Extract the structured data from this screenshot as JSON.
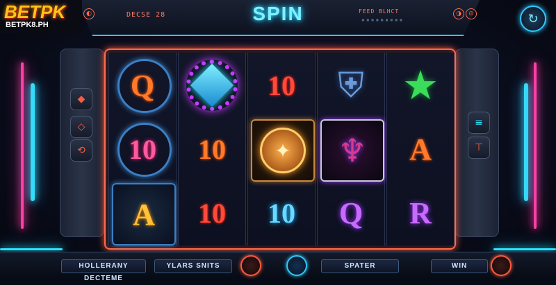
{
  "logo": {
    "main": "BETPK",
    "sub": "BETPK8.PH"
  },
  "topbar": {
    "title": "SPIN",
    "left_label": "DECSE  28",
    "right_label": "FEED BLHCT"
  },
  "reels": [
    [
      {
        "symbol": "Q",
        "style": "orange ring"
      },
      {
        "symbol": "10",
        "style": "pink ring"
      },
      {
        "symbol": "A",
        "style": "gold boxed"
      }
    ],
    [
      {
        "symbol": "gear-gem",
        "style": "purple"
      },
      {
        "symbol": "10",
        "style": "orange"
      },
      {
        "symbol": "10",
        "style": "red"
      }
    ],
    [
      {
        "symbol": "10",
        "style": "red"
      },
      {
        "symbol": "emblem",
        "style": "boxed"
      },
      {
        "symbol": "10",
        "style": "blue"
      }
    ],
    [
      {
        "symbol": "helmet",
        "style": "blue"
      },
      {
        "symbol": "bat",
        "style": "boxed"
      },
      {
        "symbol": "Q",
        "style": "purple"
      }
    ],
    [
      {
        "symbol": "star",
        "style": "green"
      },
      {
        "symbol": "A",
        "style": "orange"
      },
      {
        "symbol": "R",
        "style": "purple"
      }
    ]
  ],
  "bottombar": {
    "label_1": "HOLLERANY DECTEME",
    "label_2": "YLARS SNITS",
    "label_3": "SPATER",
    "label_4": "WIN"
  },
  "colors": {
    "accent_cyan": "#29e6ff",
    "accent_pink": "#ff3fa8",
    "reel_border": "#ff6a4a",
    "logo_gold": "#ffc21a"
  }
}
